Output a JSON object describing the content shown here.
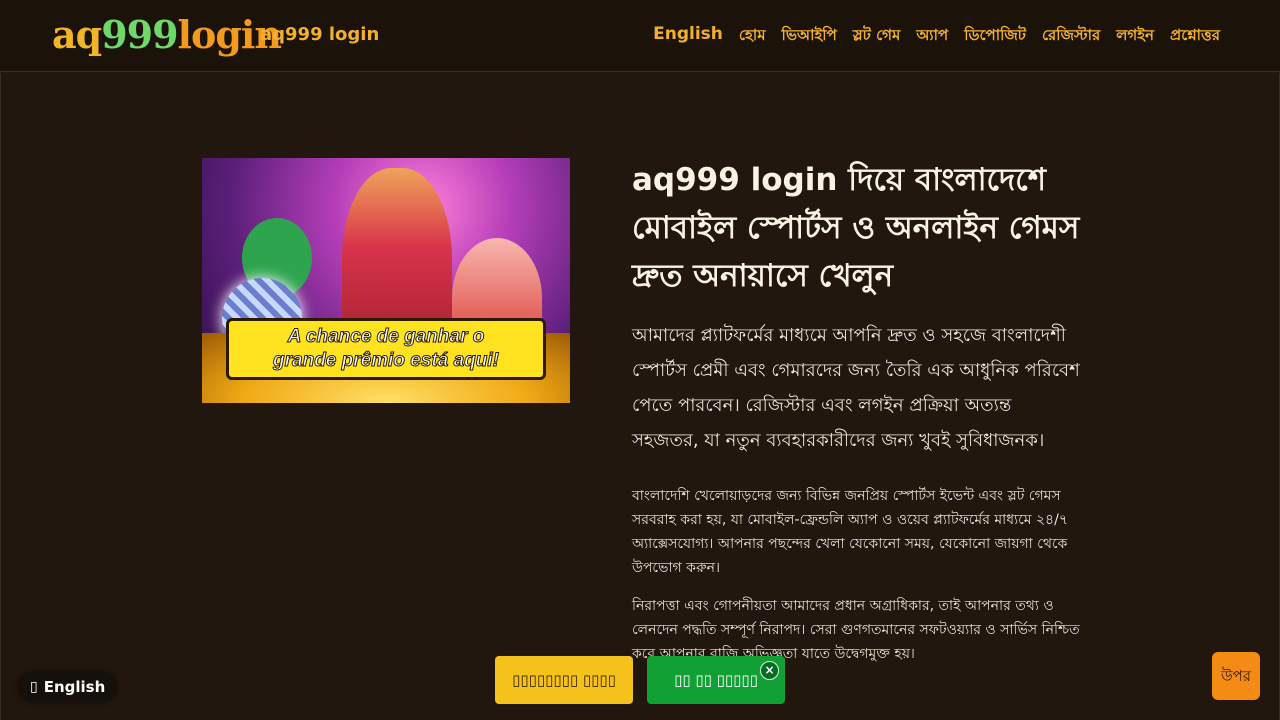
{
  "header": {
    "logo": {
      "part1": "aq",
      "part2": "999",
      "part3": "login"
    },
    "site_name": "aq999 login",
    "nav": [
      "English",
      "হোম",
      "ভিআইপি",
      "স্লট গেম",
      "অ্যাপ",
      "ডিপোজিট",
      "রেজিস্টার",
      "লগইন",
      "প্রশ্নোত্তর"
    ]
  },
  "hero": {
    "image_banner_line1": "A chance de ganhar o",
    "image_banner_line2": "grande prêmio está aqui!"
  },
  "content": {
    "title": "aq999 login দিয়ে বাংলাদেশে মোবাইল স্পোর্টস ও অনলাইন গেমস দ্রুত অনায়াসে খেলুন",
    "lead": "আমাদের প্ল্যাটফর্মের মাধ্যমে আপনি দ্রুত ও সহজে বাংলাদেশী স্পোর্টস প্রেমী এবং গেমারদের জন্য তৈরি এক আধুনিক পরিবেশ পেতে পারবেন। রেজিস্টার এবং লগইন প্রক্রিয়া অত্যন্ত সহজতর, যা নতুন ব্যবহারকারীদের জন্য খুবই সুবিধাজনক।",
    "para1": "বাংলাদেশি খেলোয়াড়দের জন্য বিভিন্ন জনপ্রিয় স্পোর্টস ইভেন্ট এবং স্লট গেমস সরবরাহ করা হয়, যা মোবাইল-ফ্রেন্ডলি অ্যাপ ও ওয়েব প্ল্যাটফর্মের মাধ্যমে ২৪/৭ অ্যাক্সেসযোগ্য। আপনার পছন্দের খেলা যেকোনো সময়, যেকোনো জায়গা থেকে উপভোগ করুন।",
    "para2": "নিরাপত্তা এবং গোপনীয়তা আমাদের প্রধান অগ্রাধিকার, তাই আপনার তথ্য ও লেনদেন পদ্ধতি সম্পূর্ণ নিরাপদ। সেরা গুণগতমানের সফটওয়্যার ও সার্ভিস নিশ্চিত করে আপনার বাজি অভিজ্ঞতা যাতে উদ্বেগমুক্ত হয়।"
  },
  "floating": {
    "language": "English",
    "register_label": "▯▯▯▯▯▯▯▯ ▯▯▯▯",
    "login_label": "▯▯ ▯▯ ▯▯▯▯▯",
    "close": "×",
    "back_to_top": "উপর"
  }
}
